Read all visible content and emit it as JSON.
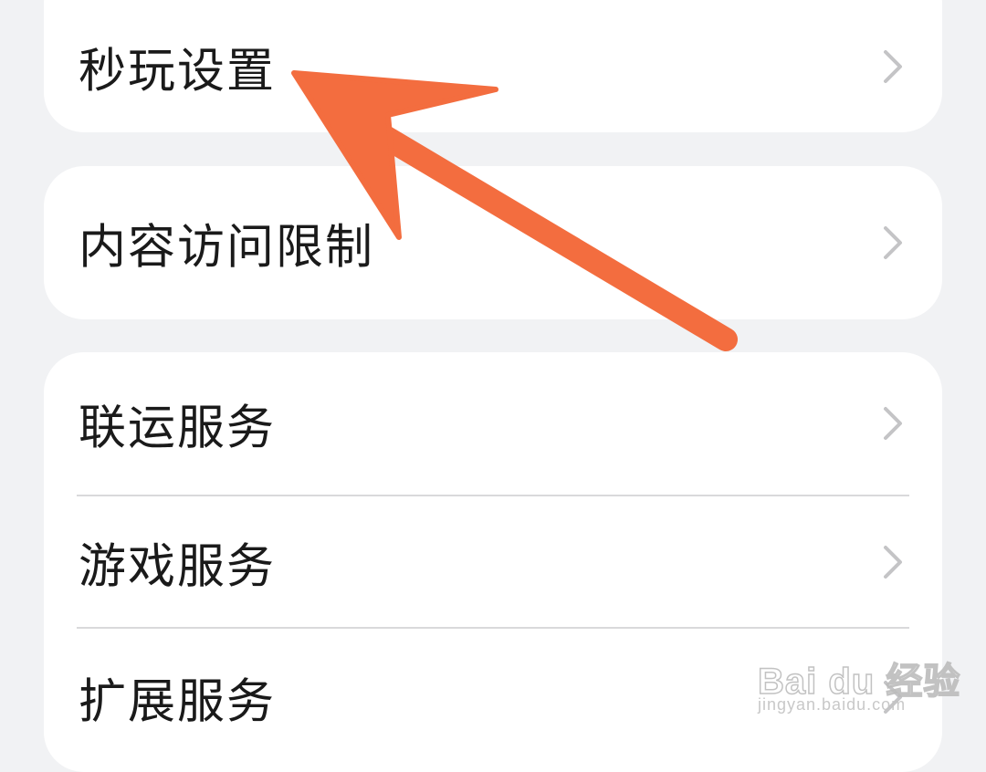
{
  "colors": {
    "background": "#f1f2f4",
    "card": "#ffffff",
    "text": "#1a1a1a",
    "chevron": "#c4c4c6",
    "divider": "#d9d9db",
    "annotation_arrow": "#f36d3f"
  },
  "settings": {
    "group1": {
      "items": [
        {
          "label": "秒玩设置",
          "icon": "chevron-right-icon"
        }
      ]
    },
    "group2": {
      "items": [
        {
          "label": "内容访问限制",
          "icon": "chevron-right-icon"
        }
      ]
    },
    "group3": {
      "items": [
        {
          "label": "联运服务",
          "icon": "chevron-right-icon"
        },
        {
          "label": "游戏服务",
          "icon": "chevron-right-icon"
        },
        {
          "label": "扩展服务",
          "icon": "chevron-right-icon"
        }
      ]
    }
  },
  "annotation": {
    "arrow_target": "秒玩设置",
    "icon": "annotation-arrow-icon"
  },
  "watermark": {
    "brand": "Bai du 经验",
    "url": "jingyan.baidu.com"
  }
}
